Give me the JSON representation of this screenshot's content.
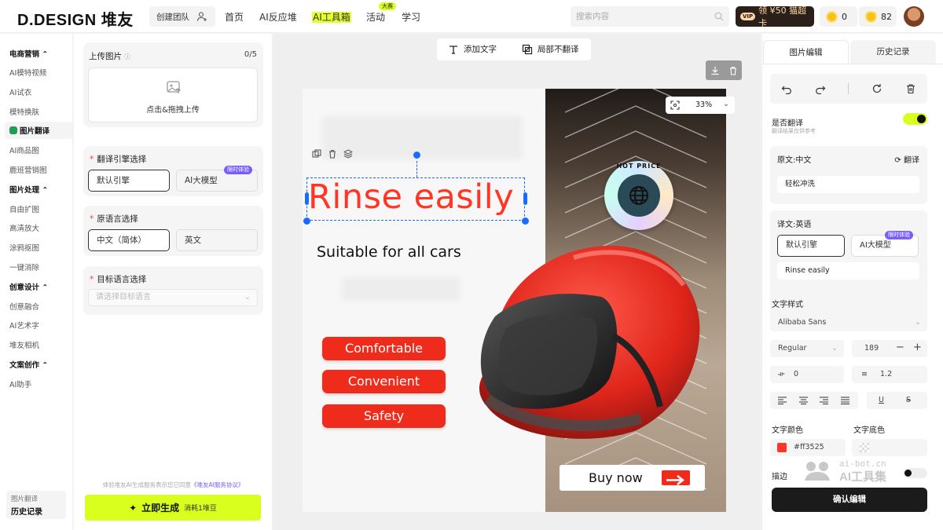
{
  "brand": {
    "logo_text": "D.DESIGN 堆友"
  },
  "header": {
    "team_button": "创建团队",
    "nav": [
      {
        "label": "首页"
      },
      {
        "label": "AI反应堆"
      },
      {
        "label": "AI工具箱",
        "active": true
      },
      {
        "label": "活动",
        "badge": "大赛"
      },
      {
        "label": "学习"
      }
    ],
    "search_placeholder": "搜索内容",
    "vip_tag": "VIP",
    "vip_text": "领 ¥50 猫超卡",
    "coins": "0",
    "beans": "82"
  },
  "sidebar": {
    "sections": [
      {
        "title": "电商营销",
        "items": [
          "AI模特视频",
          "AI试衣",
          "模特换肤",
          "图片翻译",
          "AI商品图",
          "鹿班营销图"
        ]
      },
      {
        "title": "图片处理",
        "items": [
          "自由扩图",
          "高清放大",
          "涂鸦抠图",
          "一键消除"
        ]
      },
      {
        "title": "创意设计",
        "items": [
          "创意融合",
          "AI艺术字",
          "堆友相机"
        ]
      },
      {
        "title": "文案创作",
        "items": [
          "AI助手"
        ]
      }
    ],
    "active_item": "图片翻译",
    "bottom_small": "图片翻译",
    "bottom_label": "历史记录"
  },
  "settings": {
    "upload": {
      "title": "上传图片",
      "count": "0/5",
      "cta": "点击&拖拽上传"
    },
    "engine": {
      "title": "翻译引擎选择",
      "options": [
        "默认引擎",
        "AI大模型"
      ],
      "limit_tag": "限时体验"
    },
    "source_lang": {
      "title": "原语言选择",
      "options": [
        "中文（简体）",
        "英文"
      ]
    },
    "target_lang": {
      "title": "目标语言选择",
      "placeholder": "请选择目标语言"
    },
    "notice": "体验堆友AI生成服务表示您已同意",
    "notice_link": "《堆友AI服务协议》",
    "generate_label": "立即生成",
    "generate_cost": "消耗1堆豆"
  },
  "canvas": {
    "toolbar": {
      "add_text": "添加文字",
      "no_translate": "局部不翻译"
    },
    "zoom": "33%",
    "poster": {
      "title": "Rinse easily",
      "subtitle": "Suitable for all cars",
      "features": [
        "Comfortable",
        "Convenient",
        "Safety"
      ],
      "cta": "Buy now",
      "sticker_text": "HOT PRICE"
    }
  },
  "editor": {
    "tabs": [
      "图片编辑",
      "历史记录"
    ],
    "translate_label": "是否翻译",
    "translate_hint": "翻译结果仅供参考",
    "source_label": "原文:中文",
    "translate_button": "翻译",
    "source_text": "轻松冲洗",
    "target_label": "译文:英语",
    "engines": [
      "默认引擎",
      "AI大模型"
    ],
    "limit_tag": "限时体验",
    "target_text": "Rinse easily",
    "style_label": "文字样式",
    "font_family": "Alibaba Sans",
    "font_weight": "Regular",
    "font_size": "189",
    "letter_spacing": "0",
    "line_height": "1.2",
    "text_color_label": "文字颜色",
    "text_bg_label": "文字底色",
    "text_color": "#ff3525",
    "stroke_label": "描边",
    "confirm": "确认编辑"
  },
  "watermark": {
    "line1": "ai-bot.cn",
    "line2": "AI工具集"
  },
  "colors": {
    "accent": "#d8ff1d",
    "brand_red": "#ff3525",
    "select_blue": "#1a6bff"
  }
}
